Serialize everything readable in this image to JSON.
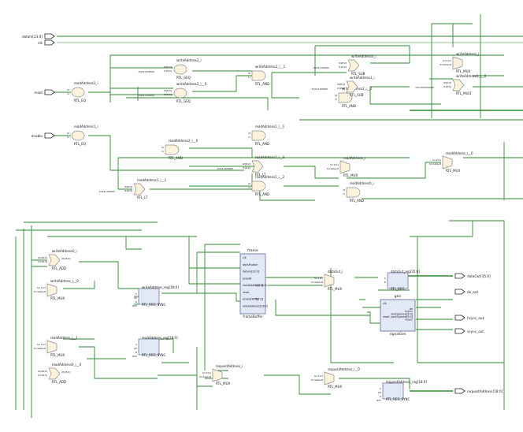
{
  "ports_in": [
    {
      "label": "dataIn[23:0]"
    },
    {
      "label": "clk"
    },
    {
      "label": "reset"
    },
    {
      "label": "enable"
    }
  ],
  "ports_out": [
    {
      "label": "dataOut[35:0]"
    },
    {
      "label": "de_out"
    },
    {
      "label": "hsync_out"
    },
    {
      "label": "vsync_out"
    },
    {
      "label": "requestAddress[18:0]"
    }
  ],
  "upper_cells": [
    {
      "name": "readAddress2_i",
      "type": "RTL_EQ",
      "pins": [
        "I0",
        "I1"
      ]
    },
    {
      "name": "writeAddress2_i",
      "type": "RTL_GEQ",
      "pins": [
        "I0[8:0]",
        "I1[8:0]"
      ],
      "const": "9'b011100000"
    },
    {
      "name": "writeAddress2_i__0",
      "type": "RTL_GEQ",
      "pins": [
        "I0[8:0]",
        "I1[8:0]"
      ],
      "const": "9'b011100000"
    },
    {
      "name": "writeAddress2_i__1",
      "type": "RTL_AND",
      "pins": [
        "I0",
        "I1"
      ]
    },
    {
      "name": "writeAddress2_i__2",
      "type": "RTL_AND",
      "pins": [
        "I0",
        "I1"
      ]
    },
    {
      "name": "writeAddress0_i",
      "type": "RTL_SUB",
      "pins": [
        "I0[8:0]",
        "I1[8:0]"
      ],
      "const": "9'b011100000"
    },
    {
      "name": "writeAddress1_i",
      "type": "RTL_SUB",
      "pins": [
        "I0[8:0]",
        "I1[8:0]"
      ],
      "const": "9'b011100000"
    },
    {
      "name": "writeAddress_i",
      "type": "RTL_MUX",
      "pins": [
        "S=1'b1",
        "S=default"
      ]
    },
    {
      "name": "writeAddress1_i__0",
      "type": "RTL_MULT",
      "pins": [
        "I0[9:0]",
        "I1[8:0]"
      ],
      "const": "10'b1010000000"
    },
    {
      "name": "readAddress1_i",
      "type": "RTL_EQ",
      "pins": [
        "I0",
        "I1"
      ]
    },
    {
      "name": "readAddress2_i__0",
      "type": "RTL_AND",
      "pins": [
        "I0",
        "I1"
      ]
    },
    {
      "name": "readAddress2_i__1",
      "type": "RTL_AND",
      "pins": [
        "I0",
        "I1"
      ]
    },
    {
      "name": "readAddress1_i__0",
      "type": "RTL_LT",
      "pins": [
        "I0[8:0]",
        "I1[8:0]"
      ],
      "const": "9'b011100000"
    },
    {
      "name": "readAddress1_i__1",
      "type": "RTL_LT",
      "pins": [
        "I0[8:0]",
        "I1[8:0]"
      ],
      "const": "9'b011100000"
    },
    {
      "name": "readAddress2_i__2",
      "type": "RTL_AND",
      "pins": [
        "I0",
        "I1"
      ]
    },
    {
      "name": "readAddress_i",
      "type": "RTL_MUX",
      "pins": [
        "S=1'b1",
        "S=default"
      ]
    },
    {
      "name": "readAddress_i__0",
      "type": "RTL_MUX",
      "pins": [
        "S=1'b1",
        "S=default"
      ]
    },
    {
      "name": "readAddress0_i",
      "type": "RTL_AND",
      "pins": [
        "I0",
        "I1"
      ]
    }
  ],
  "lower_cells": [
    {
      "name": "writeAddress0_i",
      "type": "RTL_ADD",
      "pins": [
        "I0[18:0]",
        "I1[18:0]"
      ],
      "out": "O[18:0]"
    },
    {
      "name": "writeAddress_i__0",
      "type": "RTL_MUX",
      "pins": [
        "S=1'b1",
        "S=default"
      ]
    },
    {
      "name": "writeAddress_reg[18:0]",
      "type": "RTL_REG_SYNC",
      "pins": [
        "C",
        "CE",
        "D",
        "RST"
      ]
    },
    {
      "name": "readAddress_i__1",
      "type": "RTL_MUX",
      "pins": [
        "S=1'b1",
        "S=default"
      ]
    },
    {
      "name": "readAddress_reg[18:0]",
      "type": "RTL_REG_SYNC",
      "pins": [
        "C",
        "CE",
        "D",
        "RST"
      ]
    },
    {
      "name": "readAddress0_i__0",
      "type": "RTL_ADD",
      "pins": [
        "I0[18:0]",
        "I1[18:0]"
      ],
      "out": "O[18:0]"
    },
    {
      "name": "requestAddress_i",
      "type": "RTL_MUX",
      "pins": [
        "S=1'b1",
        "S=default"
      ]
    },
    {
      "name": "requestAddress_i__0",
      "type": "RTL_MUX",
      "pins": [
        "S=1'b1",
        "S=default"
      ]
    },
    {
      "name": "requestAddress_reg[18:0]",
      "type": "RTL_REG_SYNC",
      "pins": [
        "C",
        "CE",
        "D",
        "RST"
      ]
    },
    {
      "name": "dataOut_i",
      "type": "RTL_MUX",
      "pins": [
        "S=1'b1",
        "S=default"
      ]
    },
    {
      "name": "dataOut_reg[35:0]",
      "type": "RTL_REG",
      "pins": [
        "C",
        "D"
      ]
    }
  ],
  "frame_block": {
    "name": "frame",
    "type": "frameBuffer",
    "pins_in": [
      "clk",
      "dataEnable",
      "dataIn[23:0]",
      "pixelIB",
      "readAddress[18:0]",
      "reset",
      "enableWrite",
      "writeAddress[18:0]"
    ],
    "pins_out": [
      "Q[7:0]",
      "Y[7:0]"
    ]
  },
  "gen_block": {
    "name": "gen",
    "type": "signalGen",
    "pins_in": [
      "clk",
      "reset"
    ],
    "pins_out": [
      "de",
      "hsync",
      "xoutSponse[9:0]",
      "youtSponse[9:0]",
      "vsync"
    ]
  },
  "colors": {
    "wire": "#2f8a2f",
    "block_fill": "#e3e8f6",
    "block_stroke": "#5a6a96",
    "gate_fill": "#fdf2dc",
    "gate_stroke": "#8a8a8a",
    "text": "#1a1a1a"
  }
}
